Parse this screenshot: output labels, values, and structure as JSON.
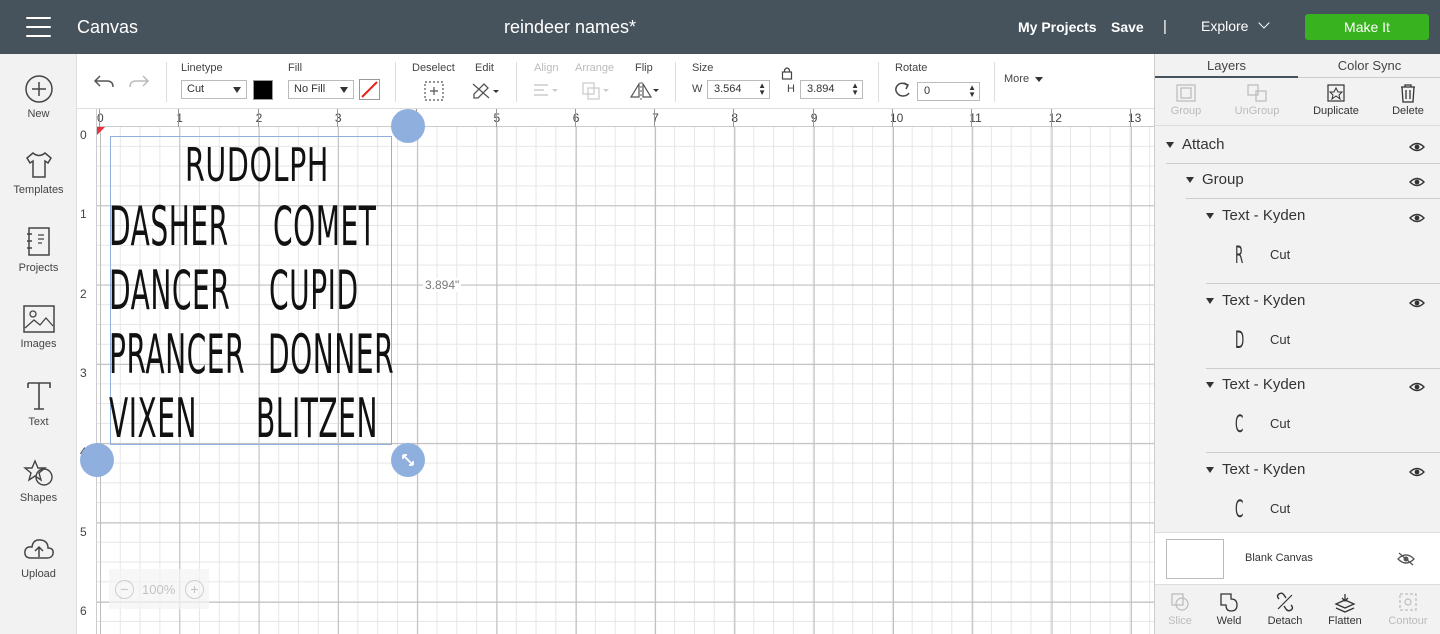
{
  "topbar": {
    "app_title": "Canvas",
    "doc_title": "reindeer names*",
    "my_projects": "My Projects",
    "save": "Save",
    "separator": "|",
    "explore": "Explore",
    "make_it": "Make It"
  },
  "leftnav": [
    {
      "label": "New",
      "icon": "plus-circle-icon"
    },
    {
      "label": "Templates",
      "icon": "tshirt-icon"
    },
    {
      "label": "Projects",
      "icon": "notebook-icon"
    },
    {
      "label": "Images",
      "icon": "image-icon"
    },
    {
      "label": "Text",
      "icon": "text-icon"
    },
    {
      "label": "Shapes",
      "icon": "shapes-icon"
    },
    {
      "label": "Upload",
      "icon": "cloud-upload-icon"
    }
  ],
  "toolbar": {
    "linetype_label": "Linetype",
    "linetype_value": "Cut",
    "fill_label": "Fill",
    "fill_value": "No Fill",
    "deselect_label": "Deselect",
    "edit_label": "Edit",
    "align_label": "Align",
    "arrange_label": "Arrange",
    "flip_label": "Flip",
    "size_label": "Size",
    "w_label": "W",
    "w_value": "3.564",
    "h_label": "H",
    "h_value": "3.894",
    "rotate_label": "Rotate",
    "rotate_value": "0",
    "more_label": "More",
    "colors": {
      "linetype_swatch": "#000000",
      "fill_slash": "#e0261b"
    }
  },
  "canvas": {
    "ruler_top": [
      "0",
      "1",
      "2",
      "3",
      "4",
      "5",
      "6",
      "7",
      "8",
      "9",
      "10",
      "11",
      "12",
      "13"
    ],
    "ruler_left": [
      "0",
      "1",
      "2",
      "3",
      "4",
      "5",
      "6"
    ],
    "dimension_label": "3.894\"",
    "zoom": "100%",
    "design": {
      "title": "RUDOLPH",
      "rows": [
        [
          "DASHER",
          "COMET"
        ],
        [
          "DANCER",
          "CUPID"
        ],
        [
          "PRANCER",
          "DONNER"
        ],
        [
          "VIXEN",
          "BLITZEN"
        ]
      ]
    }
  },
  "rightpanel": {
    "tabs": [
      "Layers",
      "Color Sync"
    ],
    "actions": [
      {
        "label": "Group",
        "enabled": false
      },
      {
        "label": "UnGroup",
        "enabled": false
      },
      {
        "label": "Duplicate",
        "enabled": true
      },
      {
        "label": "Delete",
        "enabled": true
      }
    ],
    "layers": {
      "attach": "Attach",
      "group": "Group",
      "texts": [
        {
          "name": "Text - Kyden",
          "cut": "Cut",
          "glyph": "R"
        },
        {
          "name": "Text - Kyden",
          "cut": "Cut",
          "glyph": "D"
        },
        {
          "name": "Text - Kyden",
          "cut": "Cut",
          "glyph": "C"
        },
        {
          "name": "Text - Kyden",
          "cut": "Cut",
          "glyph": "C"
        }
      ]
    },
    "blank_canvas": "Blank Canvas",
    "bottom_actions": [
      {
        "label": "Slice",
        "enabled": false
      },
      {
        "label": "Weld",
        "enabled": true
      },
      {
        "label": "Detach",
        "enabled": true
      },
      {
        "label": "Flatten",
        "enabled": true
      },
      {
        "label": "Contour",
        "enabled": false
      }
    ]
  }
}
